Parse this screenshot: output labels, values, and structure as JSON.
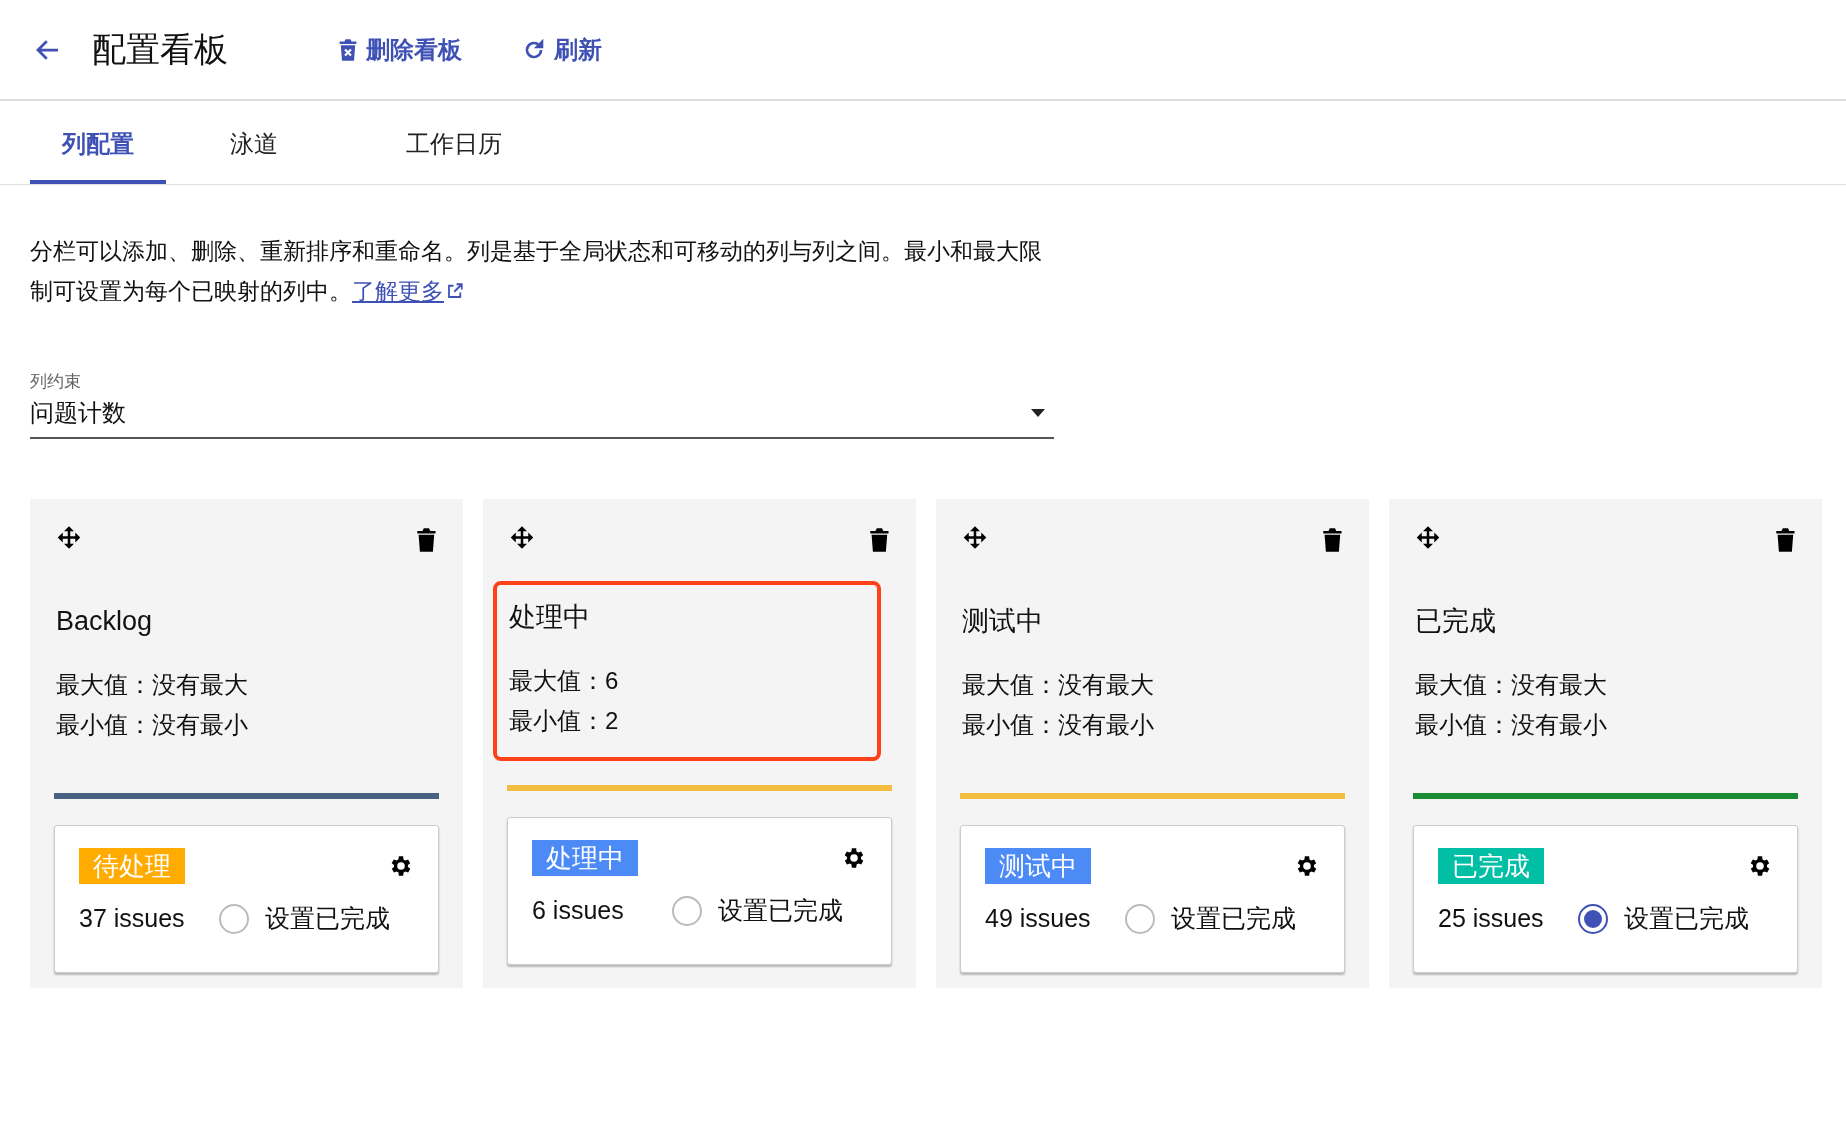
{
  "header": {
    "title": "配置看板",
    "actions": [
      {
        "kind": "delete",
        "label": "删除看板"
      },
      {
        "kind": "refresh",
        "label": "刷新"
      }
    ]
  },
  "tabs": [
    {
      "label": "列配置",
      "selected": true
    },
    {
      "label": "泳道",
      "selected": false
    },
    {
      "label": "工作日历",
      "selected": false
    }
  ],
  "description": {
    "text": "分栏可以添加、删除、重新排序和重命名。列是基于全局状态和可移动的列与列之间。最小和最大限制可设置为每个已映射的列中。",
    "link": "了解更多"
  },
  "constraint_select": {
    "label": "列约束",
    "value": "问题计数"
  },
  "columns": [
    {
      "name": "Backlog",
      "max": "最大值：没有最大",
      "min": "最小值：没有最小",
      "highlighted": false,
      "color": "#4a6282",
      "status": {
        "label": "待处理",
        "color": "#ffab00"
      },
      "issues": "37 issues",
      "done_label": "设置已完成",
      "selected": false
    },
    {
      "name": "处理中",
      "max": "最大值：6",
      "min": "最小值：2",
      "highlighted": true,
      "color": "#f3bd42",
      "status": {
        "label": "处理中",
        "color": "#4c8bf5"
      },
      "issues": "6 issues",
      "done_label": "设置已完成",
      "selected": false
    },
    {
      "name": "测试中",
      "max": "最大值：没有最大",
      "min": "最小值：没有最小",
      "highlighted": false,
      "color": "#f3bd42",
      "status": {
        "label": "测试中",
        "color": "#4c8bf5"
      },
      "issues": "49 issues",
      "done_label": "设置已完成",
      "selected": false
    },
    {
      "name": "已完成",
      "max": "最大值：没有最大",
      "min": "最小值：没有最小",
      "highlighted": false,
      "color": "#1a8a33",
      "status": {
        "label": "已完成",
        "color": "#00bfa5"
      },
      "issues": "25 issues",
      "done_label": "设置已完成",
      "selected": true
    }
  ]
}
